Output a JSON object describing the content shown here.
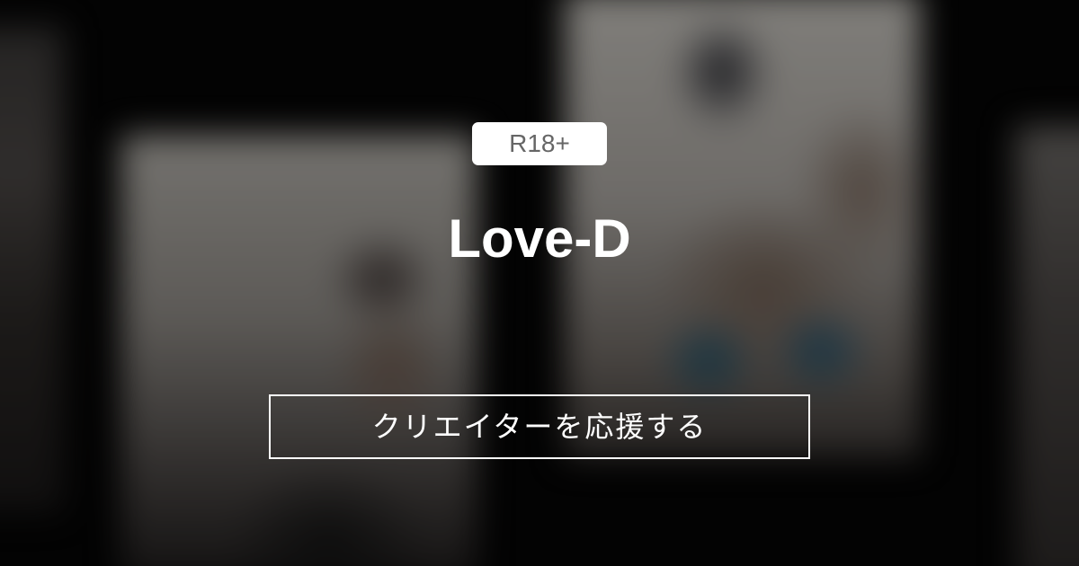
{
  "badge": {
    "label": "R18+"
  },
  "creator": {
    "name": "Love-D"
  },
  "actions": {
    "support_label": "クリエイターを応援する"
  },
  "colors": {
    "background": "#050505",
    "badge_bg": "#ffffff",
    "badge_text": "#666666",
    "text": "#ffffff",
    "button_border": "#ffffff"
  }
}
